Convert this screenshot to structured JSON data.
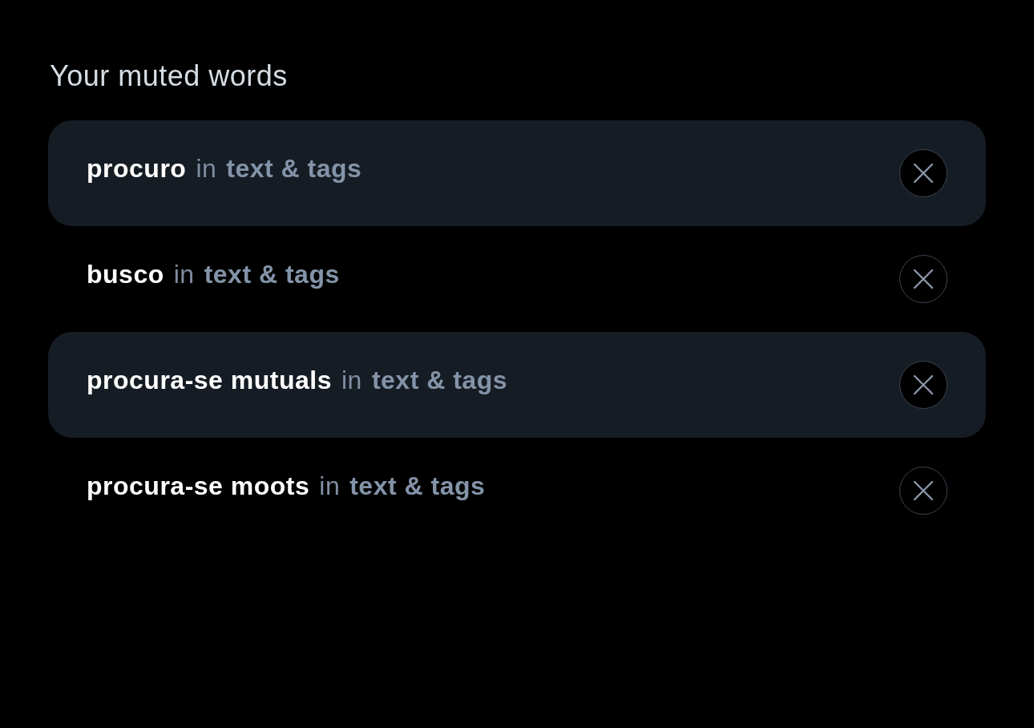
{
  "heading": "Your muted words",
  "muted_words": [
    {
      "word": "procuro",
      "connector": "in",
      "target": "text & tags"
    },
    {
      "word": "busco",
      "connector": "in",
      "target": "text & tags"
    },
    {
      "word": "procura-se mutuals",
      "connector": "in",
      "target": "text & tags"
    },
    {
      "word": "procura-se moots",
      "connector": "in",
      "target": "text & tags"
    }
  ]
}
